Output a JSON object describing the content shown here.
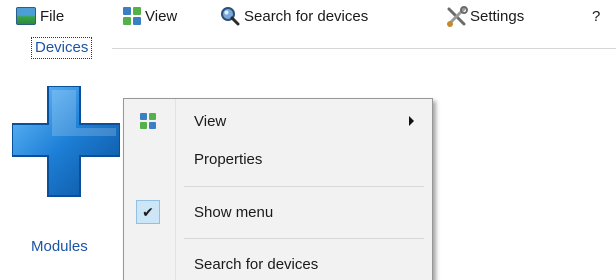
{
  "menubar": {
    "file": {
      "label": "File",
      "icon": "monitor-icon"
    },
    "view": {
      "label": "View",
      "icon": "grid-view-icon"
    },
    "search": {
      "label": "Search for devices",
      "icon": "magnifier-icon"
    },
    "settings": {
      "label": "Settings",
      "icon": "tools-icon"
    },
    "help": {
      "label": "?"
    }
  },
  "devices_group": {
    "label": "Devices",
    "modules": {
      "label": "Modules",
      "icon": "blue-plus-icon"
    }
  },
  "context_menu": {
    "items": [
      {
        "label": "View",
        "icon": "grid-view-icon",
        "has_submenu": true
      },
      {
        "label": "Properties"
      },
      {
        "label": "Show menu",
        "checked": true
      },
      {
        "label": "Search for devices"
      }
    ]
  },
  "colors": {
    "accent_text": "#1b55a6",
    "menu_bg": "#f2f2f2",
    "check_bg": "#cde6f7"
  }
}
